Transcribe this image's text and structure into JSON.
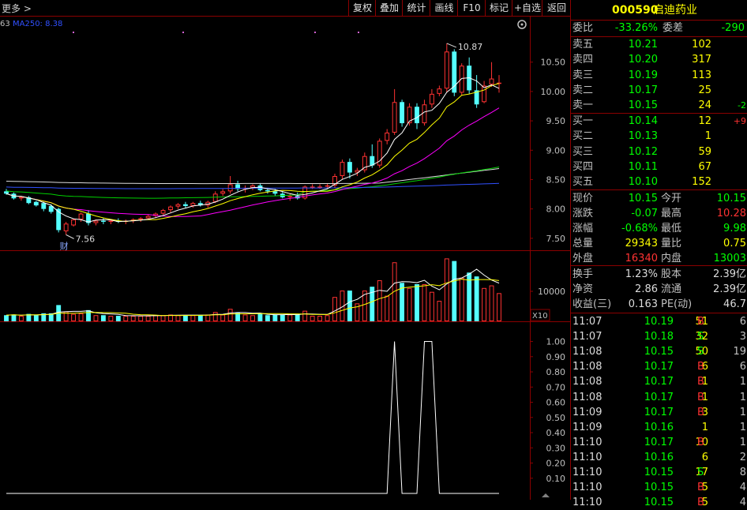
{
  "toolbar": {
    "more": "更多 >",
    "buttons": [
      "复权",
      "叠加",
      "统计",
      "画线",
      "F10",
      "标记",
      "+自选",
      "返回"
    ]
  },
  "stock": {
    "code": "000590",
    "name": "启迪药业"
  },
  "indicator_text": {
    "ma250": "MA250: 8.38",
    "ma_prefix": "63"
  },
  "colors": {
    "up": "#ff3232",
    "down": "#54ffff",
    "white": "#ffffff",
    "yellow": "#ffff00",
    "magenta": "#ff00ff",
    "green": "#00d000",
    "blue": "#3050ff",
    "gray_white": "#dcdcdc"
  },
  "order_book": {
    "weibi_label": "委比",
    "weibi": "-33.26%",
    "weicha_label": "委差",
    "weicha": "-290",
    "asks": [
      {
        "label": "卖五",
        "price": "10.21",
        "vol": "102",
        "chg": ""
      },
      {
        "label": "卖四",
        "price": "10.20",
        "vol": "317",
        "chg": ""
      },
      {
        "label": "卖三",
        "price": "10.19",
        "vol": "113",
        "chg": ""
      },
      {
        "label": "卖二",
        "price": "10.17",
        "vol": "25",
        "chg": ""
      },
      {
        "label": "卖一",
        "price": "10.15",
        "vol": "24",
        "chg": "-2"
      }
    ],
    "bids": [
      {
        "label": "买一",
        "price": "10.14",
        "vol": "12",
        "chg": "+9"
      },
      {
        "label": "买二",
        "price": "10.13",
        "vol": "1",
        "chg": ""
      },
      {
        "label": "买三",
        "price": "10.12",
        "vol": "59",
        "chg": ""
      },
      {
        "label": "买四",
        "price": "10.11",
        "vol": "67",
        "chg": ""
      },
      {
        "label": "买五",
        "price": "10.10",
        "vol": "152",
        "chg": ""
      }
    ]
  },
  "quote": [
    {
      "l1": "现价",
      "v1": "10.15",
      "l2": "今开",
      "v2": "10.15"
    },
    {
      "l1": "涨跌",
      "v1": "-0.07",
      "l2": "最高",
      "v2": "10.28"
    },
    {
      "l1": "涨幅",
      "v1": "-0.68%",
      "l2": "最低",
      "v2": "9.98"
    },
    {
      "l1": "总量",
      "v1": "29343",
      "l2": "量比",
      "v2": "0.75"
    },
    {
      "l1": "外盘",
      "v1": "16340",
      "l2": "内盘",
      "v2": "13003"
    }
  ],
  "fund": [
    {
      "l1": "换手",
      "v1": "1.23%",
      "l2": "股本",
      "v2": "2.39亿"
    },
    {
      "l1": "净资",
      "v1": "2.86",
      "l2": "流通",
      "v2": "2.39亿"
    },
    {
      "l1": "收益(三)",
      "v1": "0.163",
      "l2": "PE(动)",
      "v2": "46.7"
    }
  ],
  "ticks": [
    {
      "t": "11:07",
      "p": "10.19",
      "v": "51",
      "s": "B",
      "n": "6"
    },
    {
      "t": "11:07",
      "p": "10.18",
      "v": "32",
      "s": "S",
      "n": "3"
    },
    {
      "t": "11:08",
      "p": "10.15",
      "v": "50",
      "s": "S",
      "n": "19"
    },
    {
      "t": "11:08",
      "p": "10.17",
      "v": "6",
      "s": "B",
      "n": "6"
    },
    {
      "t": "11:08",
      "p": "10.17",
      "v": "1",
      "s": "B",
      "n": "1"
    },
    {
      "t": "11:08",
      "p": "10.17",
      "v": "1",
      "s": "B",
      "n": "1"
    },
    {
      "t": "11:09",
      "p": "10.17",
      "v": "3",
      "s": "B",
      "n": "1"
    },
    {
      "t": "11:09",
      "p": "10.16",
      "v": "1",
      "s": "",
      "n": "1"
    },
    {
      "t": "11:10",
      "p": "10.17",
      "v": "10",
      "s": "B",
      "n": "1"
    },
    {
      "t": "11:10",
      "p": "10.16",
      "v": "6",
      "s": "",
      "n": "2"
    },
    {
      "t": "11:10",
      "p": "10.15",
      "v": "17",
      "s": "S",
      "n": "8"
    },
    {
      "t": "11:10",
      "p": "10.15",
      "v": "5",
      "s": "B",
      "n": "4"
    },
    {
      "t": "11:10",
      "p": "10.15",
      "v": "5",
      "s": "B",
      "n": "4"
    }
  ],
  "chart_data": {
    "type": "candlestick",
    "price_axis": {
      "ticks": [
        "10.50",
        "10.00",
        "9.50",
        "9.00",
        "8.50",
        "8.00",
        "7.50"
      ],
      "values": [
        10.5,
        10.0,
        9.5,
        9.0,
        8.5,
        8.0,
        7.5
      ],
      "ylim": [
        7.35,
        10.98
      ]
    },
    "annotations": {
      "high_label": "10.87",
      "high": 10.87,
      "low_label": "7.56",
      "low": 7.56,
      "finance_mark": "财"
    },
    "candles": [
      [
        8.3,
        8.34,
        8.24,
        8.26
      ],
      [
        8.26,
        8.28,
        8.16,
        8.18
      ],
      [
        8.18,
        8.22,
        8.14,
        8.2
      ],
      [
        8.2,
        8.22,
        8.08,
        8.1
      ],
      [
        8.12,
        8.14,
        8.04,
        8.06
      ],
      [
        8.1,
        8.12,
        7.96,
        8.0
      ],
      [
        8.05,
        8.08,
        7.92,
        7.95
      ],
      [
        8.0,
        8.02,
        7.6,
        7.64
      ],
      [
        7.62,
        7.78,
        7.56,
        7.75
      ],
      [
        7.72,
        7.84,
        7.7,
        7.82
      ],
      [
        7.82,
        7.94,
        7.78,
        7.92
      ],
      [
        7.92,
        7.98,
        7.72,
        7.76
      ],
      [
        7.76,
        7.82,
        7.72,
        7.8
      ],
      [
        7.8,
        7.84,
        7.74,
        7.78
      ],
      [
        7.78,
        7.82,
        7.74,
        7.8
      ],
      [
        7.8,
        7.84,
        7.76,
        7.78
      ],
      [
        7.78,
        7.82,
        7.74,
        7.8
      ],
      [
        7.8,
        7.84,
        7.76,
        7.82
      ],
      [
        7.82,
        7.86,
        7.78,
        7.84
      ],
      [
        7.84,
        7.9,
        7.82,
        7.88
      ],
      [
        7.88,
        7.94,
        7.84,
        7.92
      ],
      [
        7.92,
        8.0,
        7.9,
        7.98
      ],
      [
        7.98,
        8.06,
        7.94,
        8.04
      ],
      [
        8.04,
        8.1,
        8.0,
        8.08
      ],
      [
        8.08,
        8.12,
        8.02,
        8.05
      ],
      [
        8.05,
        8.12,
        8.02,
        8.1
      ],
      [
        8.1,
        8.14,
        8.04,
        8.06
      ],
      [
        8.06,
        8.14,
        8.02,
        8.12
      ],
      [
        8.12,
        8.3,
        8.1,
        8.26
      ],
      [
        8.26,
        8.34,
        8.22,
        8.3
      ],
      [
        8.3,
        8.56,
        8.26,
        8.42
      ],
      [
        8.42,
        8.48,
        8.3,
        8.34
      ],
      [
        8.34,
        8.4,
        8.28,
        8.36
      ],
      [
        8.36,
        8.42,
        8.32,
        8.4
      ],
      [
        8.4,
        8.44,
        8.3,
        8.32
      ],
      [
        8.32,
        8.36,
        8.26,
        8.3
      ],
      [
        8.3,
        8.34,
        8.22,
        8.26
      ],
      [
        8.26,
        8.3,
        8.18,
        8.2
      ],
      [
        8.2,
        8.26,
        8.14,
        8.22
      ],
      [
        8.22,
        8.28,
        8.16,
        8.18
      ],
      [
        8.18,
        8.4,
        8.16,
        8.38
      ],
      [
        8.38,
        8.42,
        8.34,
        8.38
      ],
      [
        8.38,
        8.42,
        8.34,
        8.38
      ],
      [
        8.38,
        8.44,
        8.34,
        8.4
      ],
      [
        8.4,
        8.6,
        8.36,
        8.56
      ],
      [
        8.56,
        8.84,
        8.5,
        8.8
      ],
      [
        8.8,
        8.86,
        8.52,
        8.62
      ],
      [
        8.62,
        8.7,
        8.56,
        8.66
      ],
      [
        8.66,
        8.96,
        8.62,
        8.9
      ],
      [
        8.9,
        9.1,
        8.7,
        8.74
      ],
      [
        8.74,
        9.2,
        8.7,
        9.16
      ],
      [
        9.16,
        9.36,
        9.1,
        9.3
      ],
      [
        9.3,
        10.04,
        9.26,
        9.82
      ],
      [
        9.82,
        9.86,
        9.4,
        9.46
      ],
      [
        9.46,
        9.8,
        9.42,
        9.74
      ],
      [
        9.74,
        9.8,
        9.36,
        9.46
      ],
      [
        9.46,
        9.86,
        9.42,
        9.78
      ],
      [
        9.78,
        10.04,
        9.72,
        9.96
      ],
      [
        9.96,
        10.1,
        9.92,
        10.05
      ],
      [
        10.05,
        10.82,
        9.98,
        10.68
      ],
      [
        10.68,
        10.72,
        9.92,
        9.98
      ],
      [
        9.98,
        10.48,
        9.94,
        10.44
      ],
      [
        10.44,
        10.58,
        9.96,
        10.02
      ],
      [
        10.02,
        10.28,
        9.72,
        9.78
      ],
      [
        9.82,
        10.18,
        9.8,
        10.1
      ],
      [
        10.12,
        10.5,
        10.08,
        10.22
      ],
      [
        10.15,
        10.28,
        9.98,
        10.15
      ]
    ],
    "ma_lines": {
      "MA5": {
        "color": "white"
      },
      "MA10": {
        "color": "yellow"
      },
      "MA20": {
        "color": "magenta"
      },
      "MA60": {
        "color": "green"
      },
      "MA120": {
        "color": "gray_white"
      },
      "MA250": {
        "color": "blue",
        "value": 8.38
      }
    },
    "volume_axis": {
      "ticks": [
        "10000"
      ],
      "unit": "X10"
    },
    "indicator_axis": {
      "ticks": [
        "1.00",
        "0.90",
        "0.80",
        "0.70",
        "0.60",
        "0.50",
        "0.40",
        "0.30",
        "0.20",
        "0.10"
      ],
      "ylim": [
        0,
        1.06
      ]
    },
    "indicator_series": [
      0,
      0,
      0,
      0,
      0,
      0,
      0,
      0,
      0,
      0,
      0,
      0,
      0,
      0,
      0,
      0,
      0,
      0,
      0,
      0,
      0,
      0,
      0,
      0,
      0,
      0,
      0,
      0,
      0,
      0,
      0,
      0,
      0,
      0,
      0,
      0,
      0,
      0,
      0,
      0,
      0,
      0,
      0,
      0,
      0,
      0,
      0,
      0,
      0,
      0,
      0,
      0,
      1,
      0,
      0,
      0,
      1,
      1,
      0,
      0,
      0,
      0,
      0,
      0,
      0,
      0,
      0
    ]
  }
}
